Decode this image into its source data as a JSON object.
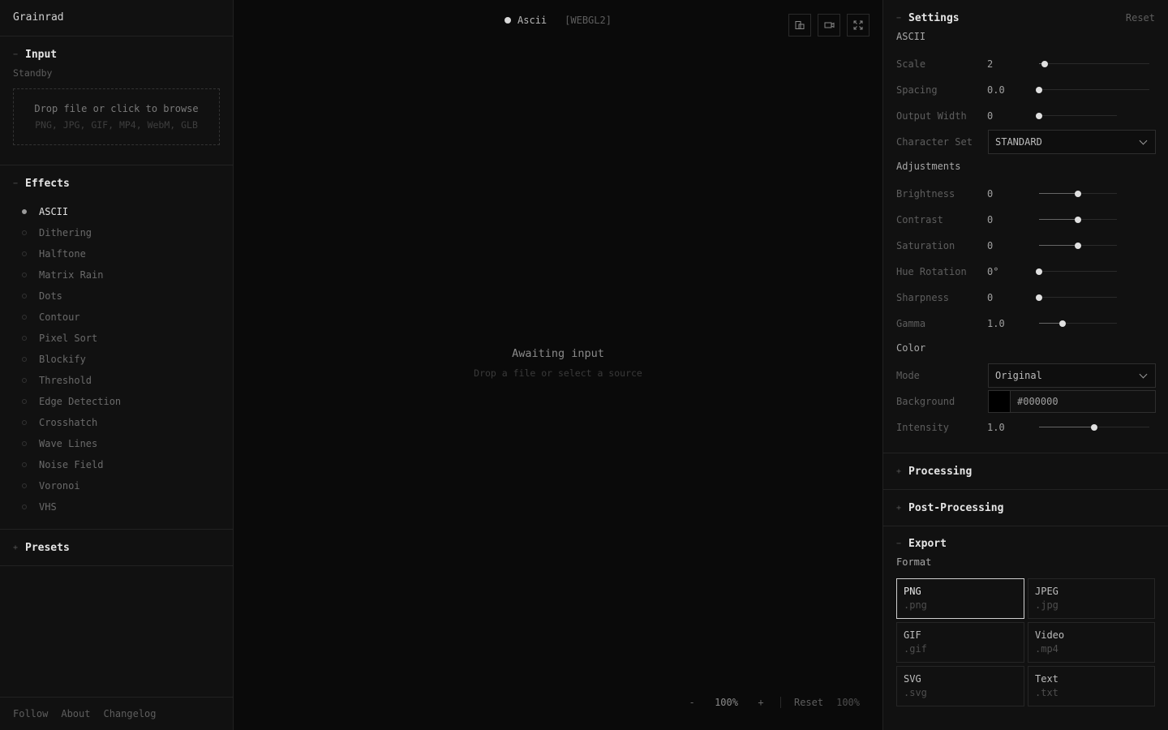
{
  "app": {
    "title": "Grainrad"
  },
  "input": {
    "title": "Input",
    "status": "Standby",
    "drop_primary": "Drop file or click to browse",
    "drop_formats": "PNG, JPG, GIF, MP4, WebM, GLB"
  },
  "effects": {
    "title": "Effects",
    "items": [
      {
        "label": "ASCII",
        "active": true
      },
      {
        "label": "Dithering"
      },
      {
        "label": "Halftone"
      },
      {
        "label": "Matrix Rain"
      },
      {
        "label": "Dots"
      },
      {
        "label": "Contour"
      },
      {
        "label": "Pixel Sort"
      },
      {
        "label": "Blockify"
      },
      {
        "label": "Threshold"
      },
      {
        "label": "Edge Detection"
      },
      {
        "label": "Crosshatch"
      },
      {
        "label": "Wave Lines"
      },
      {
        "label": "Noise Field"
      },
      {
        "label": "Voronoi"
      },
      {
        "label": "VHS"
      }
    ]
  },
  "presets": {
    "title": "Presets"
  },
  "footer": {
    "links": [
      "Follow",
      "About",
      "Changelog"
    ]
  },
  "canvas": {
    "mode": "Ascii",
    "backend": "[WEBGL2]",
    "awaiting_title": "Awaiting input",
    "awaiting_sub": "Drop a file or select a source",
    "tool_icons": [
      "compare-icon",
      "record-icon",
      "fullscreen-icon"
    ],
    "zoom": {
      "minus": "-",
      "value": "100%",
      "plus": "+",
      "reset": "Reset",
      "fit": "100%"
    }
  },
  "settings": {
    "title": "Settings",
    "reset": "Reset",
    "ascii": {
      "label": "ASCII",
      "scale": {
        "label": "Scale",
        "value": "2",
        "level": 0.05
      },
      "spacing": {
        "label": "Spacing",
        "value": "0.0",
        "level": 0.0
      },
      "output_width": {
        "label": "Output Width",
        "value": "0",
        "level": 0.0
      },
      "charset": {
        "label": "Character Set",
        "value": "STANDARD"
      }
    },
    "adjustments": {
      "label": "Adjustments",
      "rows": [
        {
          "label": "Brightness",
          "value": "0",
          "level": 0.5
        },
        {
          "label": "Contrast",
          "value": "0",
          "level": 0.5
        },
        {
          "label": "Saturation",
          "value": "0",
          "level": 0.5
        },
        {
          "label": "Hue Rotation",
          "value": "0°",
          "level": 0.0
        },
        {
          "label": "Sharpness",
          "value": "0",
          "level": 0.0
        },
        {
          "label": "Gamma",
          "value": "1.0",
          "level": 0.3
        }
      ]
    },
    "color": {
      "label": "Color",
      "mode": {
        "label": "Mode",
        "value": "Original"
      },
      "background": {
        "label": "Background",
        "value": "#000000",
        "swatch": "#000000"
      },
      "intensity": {
        "label": "Intensity",
        "value": "1.0",
        "level": 0.5
      }
    }
  },
  "processing": {
    "title": "Processing"
  },
  "post_processing": {
    "title": "Post-Processing"
  },
  "export": {
    "title": "Export",
    "format_label": "Format",
    "formats": [
      {
        "name": "PNG",
        "ext": ".png",
        "selected": true
      },
      {
        "name": "JPEG",
        "ext": ".jpg"
      },
      {
        "name": "GIF",
        "ext": ".gif"
      },
      {
        "name": "Video",
        "ext": ".mp4"
      },
      {
        "name": "SVG",
        "ext": ".svg"
      },
      {
        "name": "Text",
        "ext": ".txt"
      }
    ]
  },
  "colors": {
    "background": "#0a0a0a",
    "panel": "#111111",
    "accent": "#e0e0e0",
    "border": "#222222"
  }
}
